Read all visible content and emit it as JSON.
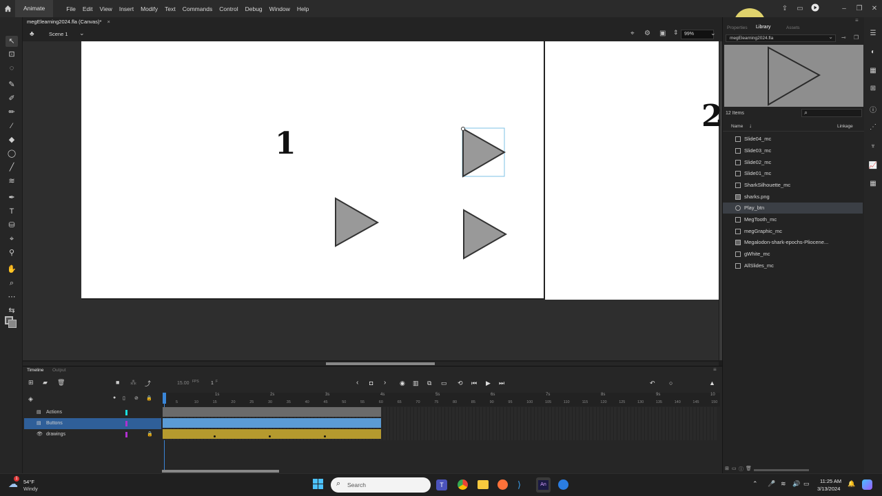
{
  "menubar": {
    "app_name": "Animate",
    "items": [
      "File",
      "Edit",
      "View",
      "Insert",
      "Modify",
      "Text",
      "Commands",
      "Control",
      "Debug",
      "Window",
      "Help"
    ]
  },
  "document": {
    "tab_title": "megElearning2024.fla (Canvas)*",
    "close_glyph": "×",
    "scene": "Scene 1",
    "zoom": "99%"
  },
  "stage": {
    "slide1_number": "1",
    "slide2_number": "2"
  },
  "library": {
    "tab_properties": "Properties",
    "tab_library": "Library",
    "tab_assets": "Assets",
    "doc_select": "megElearning2024.fla",
    "count": "12 Items",
    "col_name": "Name",
    "col_linkage": "Linkage",
    "items": [
      {
        "label": "Slide04_mc",
        "icon": "movieclip-icon"
      },
      {
        "label": "Slide03_mc",
        "icon": "movieclip-icon"
      },
      {
        "label": "Slide02_mc",
        "icon": "movieclip-icon"
      },
      {
        "label": "Slide01_mc",
        "icon": "movieclip-icon"
      },
      {
        "label": "SharkSilhouette_mc",
        "icon": "movieclip-icon"
      },
      {
        "label": "sharks.png",
        "icon": "bitmap-icon"
      },
      {
        "label": "Play_btn",
        "icon": "button-symbol-icon",
        "selected": true
      },
      {
        "label": "MegTooth_mc",
        "icon": "movieclip-icon"
      },
      {
        "label": "megGraphic_mc",
        "icon": "movieclip-icon"
      },
      {
        "label": "Megalodon-shark-epochs-Pliocene...",
        "icon": "bitmap-icon"
      },
      {
        "label": "gWhite_mc",
        "icon": "movieclip-icon"
      },
      {
        "label": "AllSlides_mc",
        "icon": "movieclip-icon"
      }
    ]
  },
  "timeline": {
    "tab_timeline": "Timeline",
    "tab_output": "Output",
    "fps": "15.00",
    "fps_unit": "FPS",
    "frame": "1",
    "frame_unit": "F",
    "seconds_labels": [
      "1s",
      "2s",
      "3s",
      "4s",
      "5s",
      "6s",
      "7s",
      "8s",
      "9s",
      "10"
    ],
    "frame_labels": [
      "5",
      "10",
      "15",
      "20",
      "25",
      "30",
      "35",
      "40",
      "45",
      "50",
      "55",
      "60",
      "65",
      "70",
      "75",
      "80",
      "85",
      "90",
      "95",
      "100",
      "105",
      "110",
      "115",
      "120",
      "125",
      "130",
      "135",
      "140",
      "145",
      "150"
    ],
    "layers": [
      {
        "name": "Actions",
        "color": "#19e0e0"
      },
      {
        "name": "Buttons",
        "color": "#b030d0",
        "selected": true
      },
      {
        "name": "drawings",
        "color": "#b030d0",
        "locked": true
      }
    ]
  },
  "taskbar": {
    "weather_temp": "54°F",
    "weather_desc": "Windy",
    "search_placeholder": "Search",
    "time": "11:25 AM",
    "date": "3/13/2024"
  },
  "colors": {
    "accent": "#2f5f99",
    "triangle_fill": "#999999",
    "selection_box": "#4aa3d8",
    "layer_gold": "#b59a2e",
    "layer_blue": "#5b9bd5"
  }
}
